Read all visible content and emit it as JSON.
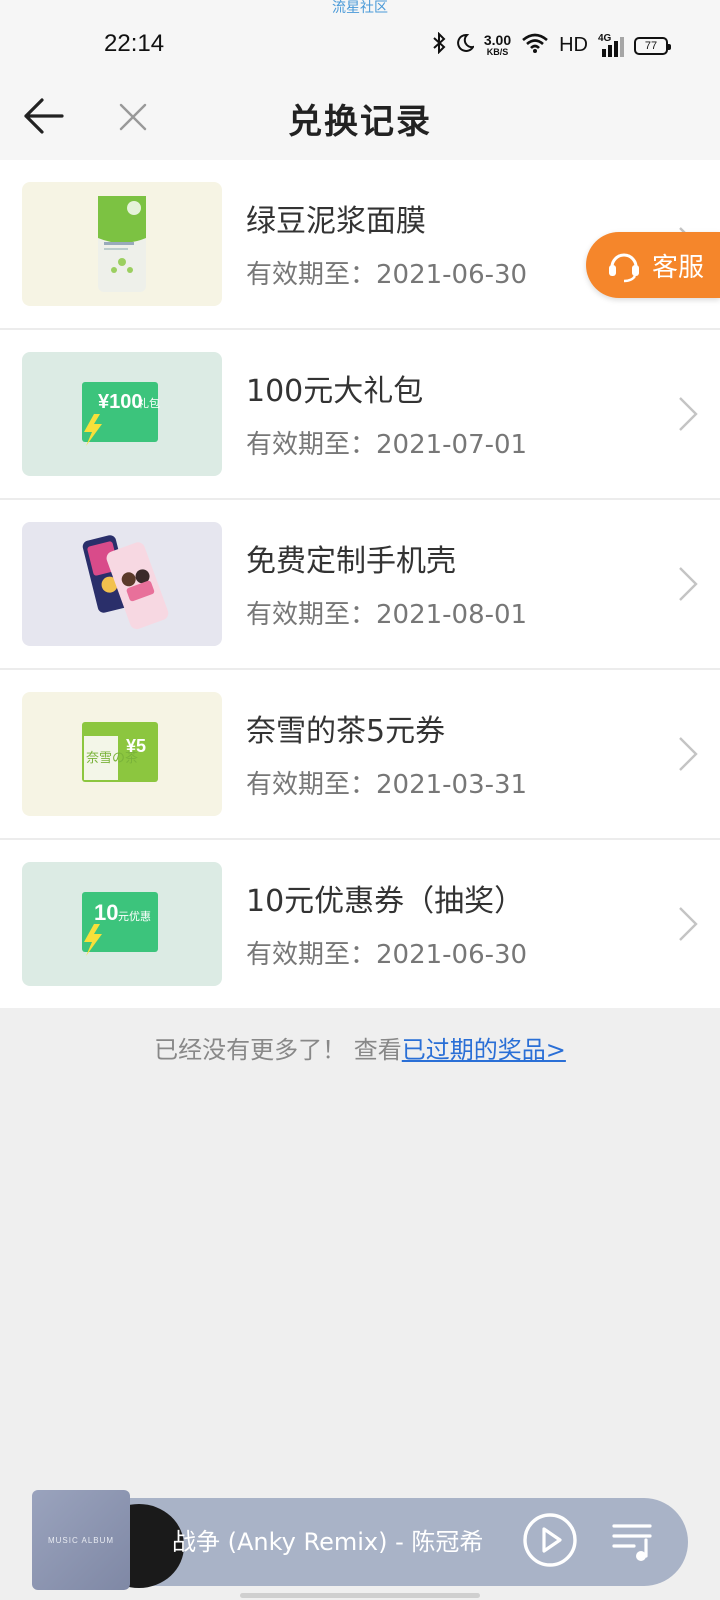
{
  "watermark": "流星社区",
  "status": {
    "time": "22:14",
    "net_speed": "3.00",
    "net_unit": "KB/S",
    "hd": "HD",
    "signal": "4G",
    "battery": "77"
  },
  "nav": {
    "title": "兑换记录"
  },
  "items": [
    {
      "title": "绿豆泥浆面膜",
      "date": "有效期至：2021-06-30",
      "thumb_bg": "#f6f4e4",
      "icon": "face-mask-pack-icon"
    },
    {
      "title": "100元大礼包",
      "date": "有效期至：2021-07-01",
      "thumb_bg": "#dcebe4",
      "icon": "gift-card-100-icon",
      "card_amount": "¥100",
      "card_suffix": "礼包"
    },
    {
      "title": "免费定制手机壳",
      "date": "有效期至：2021-08-01",
      "thumb_bg": "#e6e6ef",
      "icon": "phone-case-icon"
    },
    {
      "title": "奈雪的茶5元券",
      "date": "有效期至：2021-03-31",
      "thumb_bg": "#f6f4e4",
      "icon": "tea-coupon-icon",
      "card_left": "奈雪の茶",
      "card_amount": "¥5"
    },
    {
      "title": "10元优惠券（抽奖）",
      "date": "有效期至：2021-06-30",
      "thumb_bg": "#dcebe4",
      "icon": "coupon-10-icon",
      "card_amount": "10",
      "card_suffix": "元优惠"
    }
  ],
  "service": {
    "label": "客服"
  },
  "footer": {
    "text": "已经没有更多了！ 查看",
    "link": "已过期的奖品>"
  },
  "player": {
    "cover_text": "MUSIC ALBUM",
    "song": "战争 (Anky Remix) - 陈冠希"
  },
  "colors": {
    "accent_orange": "#f5862b",
    "link_blue": "#2a6fd6",
    "card_green": "#3cc47c",
    "card_lime": "#8cc63f"
  }
}
